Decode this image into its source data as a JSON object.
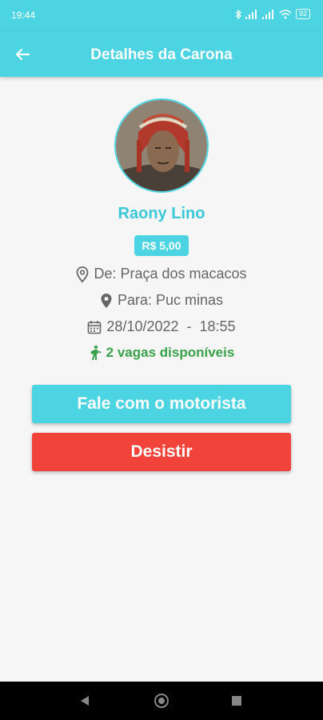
{
  "status_bar": {
    "time": "19:44",
    "battery": "92"
  },
  "app_bar": {
    "title": "Detalhes da Carona"
  },
  "ride": {
    "driver_name": "Raony Lino",
    "price": "R$ 5,00",
    "from": "De: Praça dos macacos",
    "to": "Para: Puc minas",
    "date": "28/10/2022",
    "separator": "-",
    "time": "18:55",
    "seats": "2 vagas disponíveis"
  },
  "actions": {
    "chat_label": "Fale com o motorista",
    "cancel_label": "Desistir"
  },
  "colors": {
    "primary": "#4dd4e2",
    "danger": "#f2433a",
    "success": "#3aa24a"
  },
  "icons": [
    "arrow-left-icon",
    "map-pin-outline-icon",
    "map-pin-filled-icon",
    "calendar-icon",
    "person-walking-icon"
  ]
}
